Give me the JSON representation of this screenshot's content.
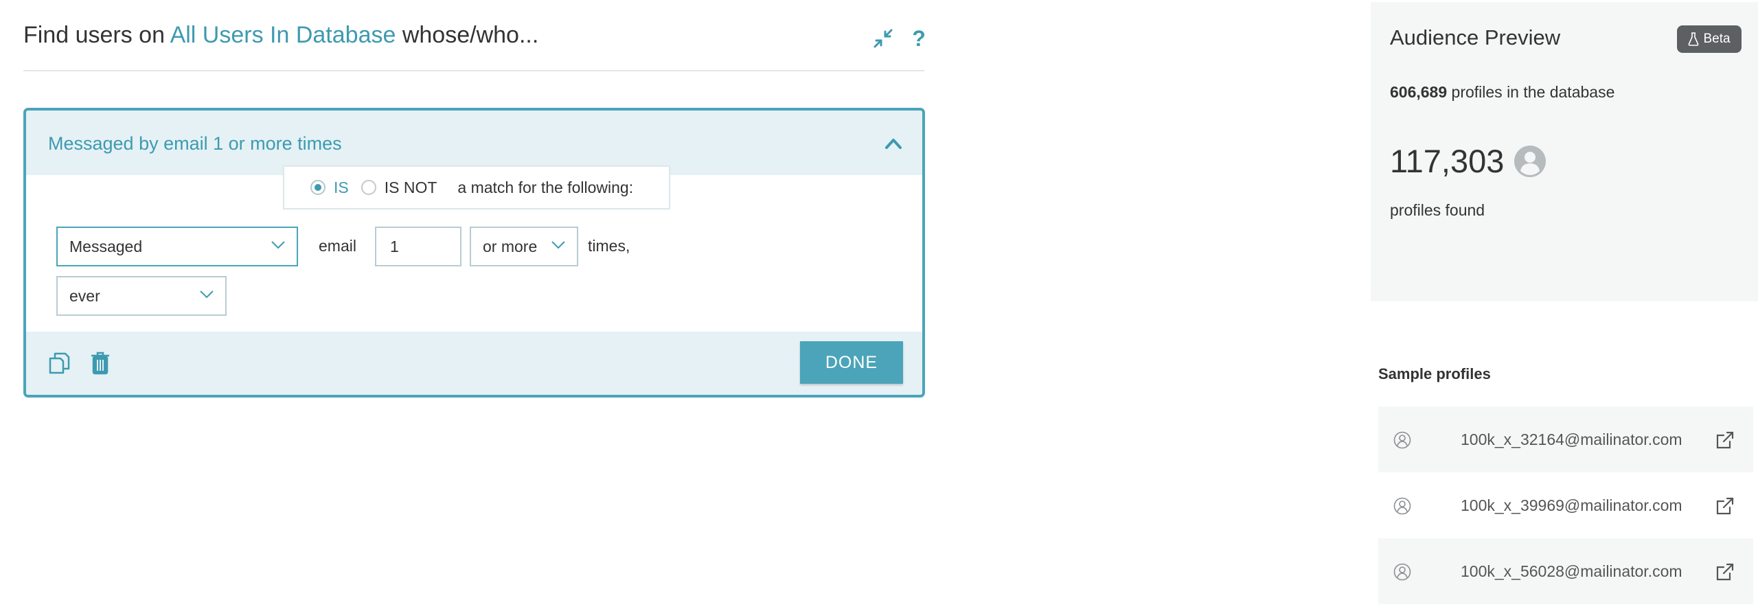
{
  "header": {
    "prefix": "Find users on",
    "database_link": "All Users In Database",
    "suffix": "whose/who..."
  },
  "icons": {
    "collapse": "collapse-arrows-icon",
    "help": "?"
  },
  "filter_card": {
    "title": "Messaged by email 1 or more times",
    "match_options": [
      "IS",
      "IS NOT"
    ],
    "selected_match": "IS",
    "match_text": "a match for the following:",
    "action_select": "Messaged",
    "channel_text": "email",
    "count_input": "1",
    "comparison_select": "or more",
    "times_text": "times,",
    "timeframe_select": "ever",
    "done_label": "DONE"
  },
  "audience_preview": {
    "title": "Audience Preview",
    "beta_label": "Beta",
    "db_count": "606,689",
    "db_count_suffix": "profiles in the database",
    "found_count": "117,303",
    "found_label": "profiles found"
  },
  "samples": {
    "title": "Sample profiles",
    "profiles": [
      "100k_x_32164@mailinator.com",
      "100k_x_39969@mailinator.com",
      "100k_x_56028@mailinator.com"
    ]
  },
  "colors": {
    "accent": "#3d9ab0",
    "card_border": "#4ba4ba",
    "card_tint": "#e5f1f5",
    "panel_bg": "#f5f7f7",
    "badge_bg": "#5c6063"
  }
}
